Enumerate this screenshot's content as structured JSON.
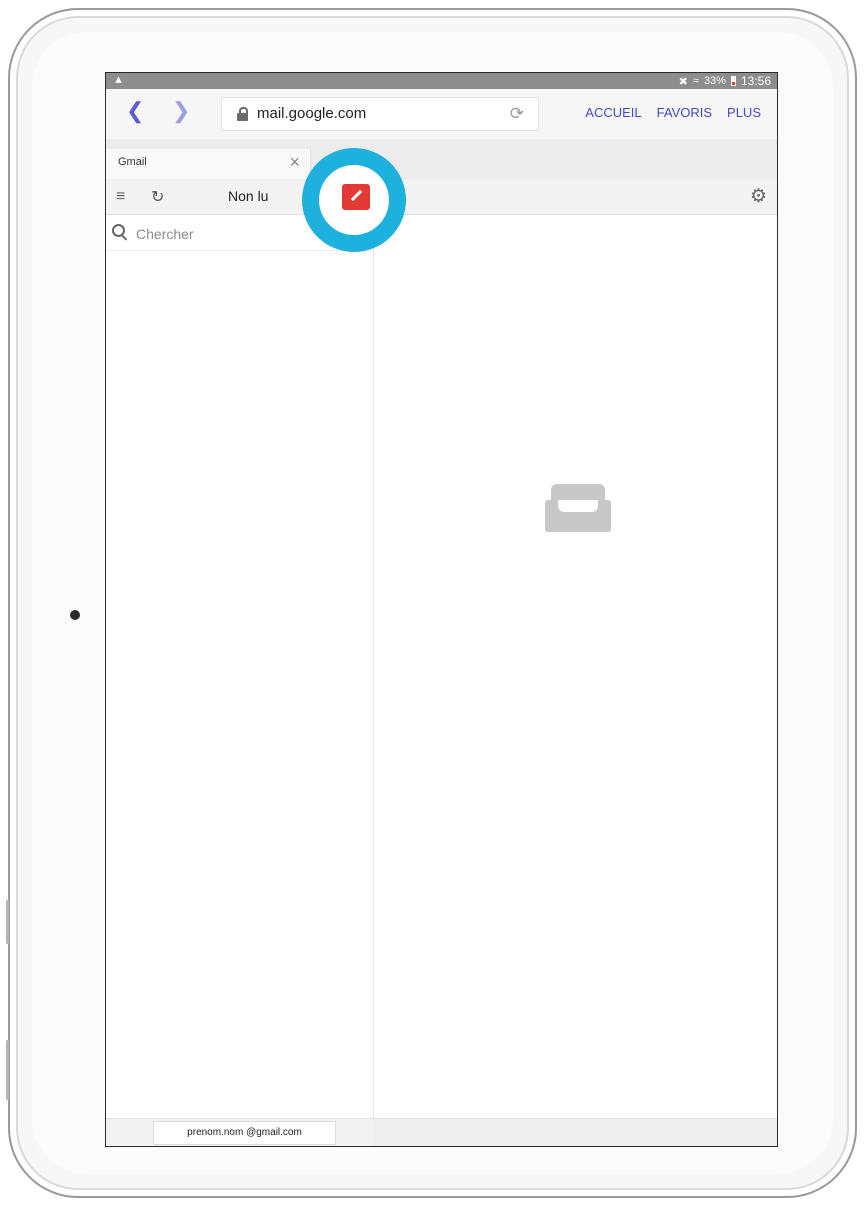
{
  "statusbar": {
    "warning_icon": "warning-icon",
    "mute_icon": "mute-icon",
    "wifi_icon": "wifi-icon",
    "battery_percent": "33%",
    "time": "13:56"
  },
  "browser": {
    "back_icon": "chevron-left-icon",
    "forward_icon": "chevron-right-icon",
    "url": "mail.google.com",
    "reload_icon": "reload-icon",
    "menu": [
      "ACCUEIL",
      "FAVORIS",
      "PLUS"
    ],
    "link_color": "#4747c4"
  },
  "tab": {
    "title": "Gmail",
    "close_icon": "close-icon"
  },
  "gmail": {
    "menu_icon": "hamburger-icon",
    "refresh_icon": "refresh-icon",
    "view_label": "Non lu",
    "compose_icon": "pencil-icon",
    "compose_color": "#e53935",
    "settings_icon": "gear-icon",
    "search_placeholder": "Chercher",
    "empty_icon": "empty-inbox-icon",
    "account": "prenom.nom @gmail.com"
  },
  "highlight": {
    "color": "#1fb1de"
  }
}
